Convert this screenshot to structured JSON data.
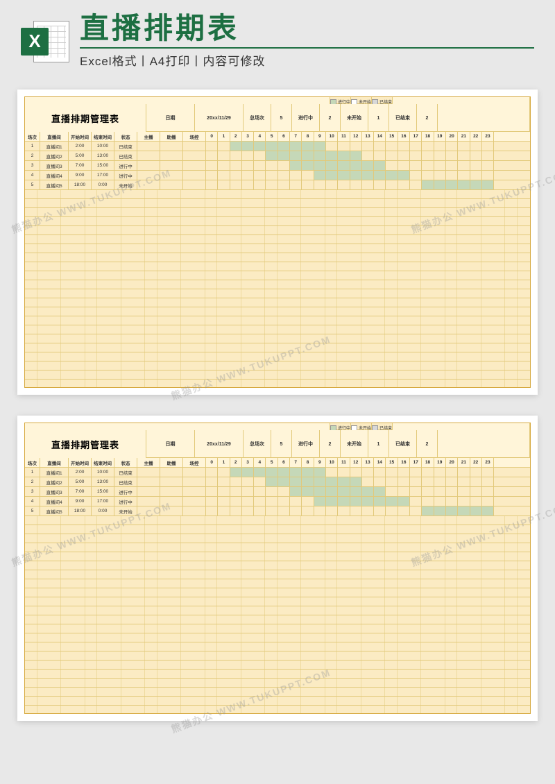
{
  "header": {
    "title": "直播排期表",
    "subtitle": "Excel格式丨A4打印丨内容可修改",
    "icon_letter": "X"
  },
  "sheet": {
    "title": "直播排期管理表",
    "stats_row": {
      "date_label": "日期",
      "date_value": "20xx/11/29",
      "total_label": "总场次",
      "total_value": "5",
      "ongoing_label": "进行中",
      "ongoing_value": "2",
      "notstart_label": "未开始",
      "notstart_value": "1",
      "finished_label": "已结束",
      "finished_value": "2"
    },
    "legend": {
      "ongoing": "进行中",
      "notstart": "未开始",
      "finished": "已结束"
    },
    "columns": {
      "idx": "场次",
      "room": "直播间",
      "start": "开始时间",
      "end": "结束时间",
      "status": "状态",
      "anchor": "主播",
      "assist": "助播",
      "control": "场控"
    },
    "hours": [
      "0",
      "1",
      "2",
      "3",
      "4",
      "5",
      "6",
      "7",
      "8",
      "9",
      "10",
      "11",
      "12",
      "13",
      "14",
      "15",
      "16",
      "17",
      "18",
      "19",
      "20",
      "21",
      "22",
      "23"
    ],
    "rows": [
      {
        "idx": "1",
        "room": "直播间1",
        "start": "2:00",
        "end": "10:00",
        "status": "已结束",
        "fillStart": 2,
        "fillEnd": 10
      },
      {
        "idx": "2",
        "room": "直播间2",
        "start": "5:00",
        "end": "13:00",
        "status": "已结束",
        "fillStart": 5,
        "fillEnd": 13
      },
      {
        "idx": "3",
        "room": "直播间3",
        "start": "7:00",
        "end": "15:00",
        "status": "进行中",
        "fillStart": 7,
        "fillEnd": 15
      },
      {
        "idx": "4",
        "room": "直播间4",
        "start": "9:00",
        "end": "17:00",
        "status": "进行中",
        "fillStart": 9,
        "fillEnd": 17
      },
      {
        "idx": "5",
        "room": "直播间5",
        "start": "18:00",
        "end": "0:00",
        "status": "未开始",
        "fillStart": 18,
        "fillEnd": 24
      }
    ]
  },
  "watermark": "熊猫办公 WWW.TUKUPPT.COM"
}
